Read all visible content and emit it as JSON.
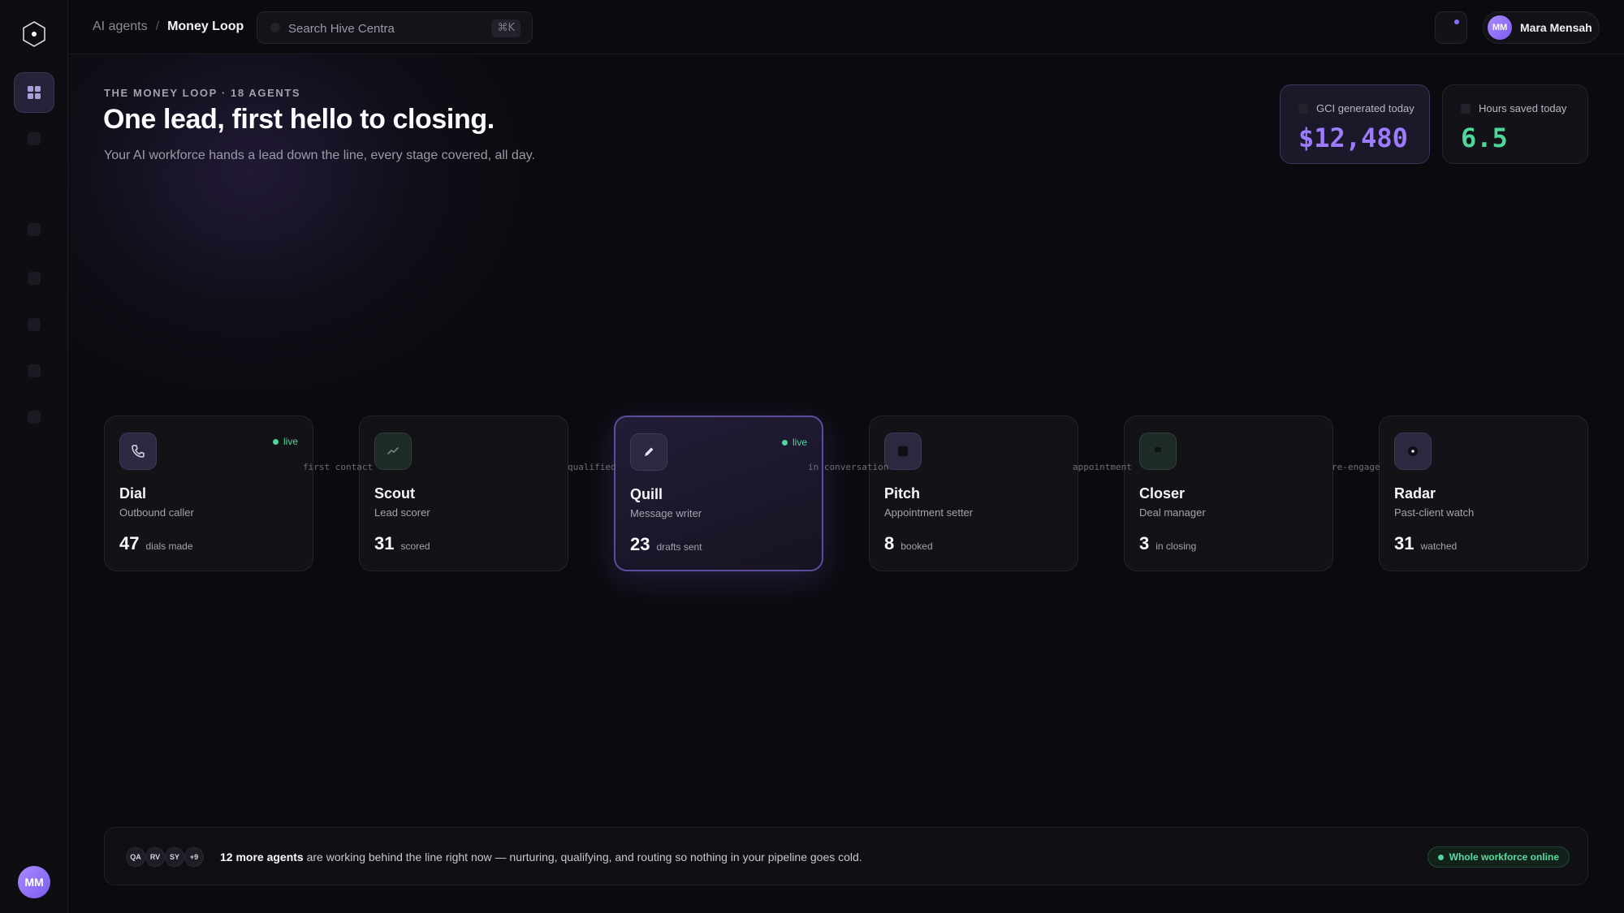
{
  "breadcrumb": {
    "parent": "AI agents",
    "separator": "/",
    "current": "Money Loop"
  },
  "search": {
    "placeholder": "Search Hive Centra",
    "shortcut": "⌘K"
  },
  "user": {
    "initials": "MM",
    "name": "Mara Mensah"
  },
  "hero": {
    "eyebrow": "THE MONEY LOOP · 18 AGENTS",
    "title": "One lead, first hello to closing.",
    "subtitle": "Your AI workforce hands a lead down the line, every stage covered, all day."
  },
  "stats": [
    {
      "label": "GCI generated today",
      "value": "$12,480",
      "color": "#9d7bff"
    },
    {
      "label": "Hours saved today",
      "value": "6.5",
      "color": "#4fd79a"
    }
  ],
  "agents": [
    {
      "name": "Dial",
      "role": "Outbound caller",
      "count": "47",
      "unit": "dials made",
      "status": "live",
      "icon": "phone-icon"
    },
    {
      "name": "Scout",
      "role": "Lead scorer",
      "count": "31",
      "unit": "scored",
      "status": "",
      "icon": "trend-icon"
    },
    {
      "name": "Quill",
      "role": "Message writer",
      "count": "23",
      "unit": "drafts sent",
      "status": "live",
      "icon": "pencil-icon"
    },
    {
      "name": "Pitch",
      "role": "Appointment setter",
      "count": "8",
      "unit": "booked",
      "status": "",
      "icon": "calendar-icon"
    },
    {
      "name": "Closer",
      "role": "Deal manager",
      "count": "3",
      "unit": "in closing",
      "status": "",
      "icon": "flag-icon"
    },
    {
      "name": "Radar",
      "role": "Past-client watch",
      "count": "31",
      "unit": "watched",
      "status": "",
      "icon": "radar-icon"
    }
  ],
  "connectors": [
    "first contact",
    "qualified",
    "in conversation",
    "appointment",
    "re-engage"
  ],
  "footer": {
    "avatars": [
      "QA",
      "RV",
      "SY",
      "+9"
    ],
    "highlight": "12 more agents",
    "text": " are working behind the line right now — nurturing, qualifying, and routing so nothing in your pipeline goes cold.",
    "status": "Whole workforce online"
  }
}
